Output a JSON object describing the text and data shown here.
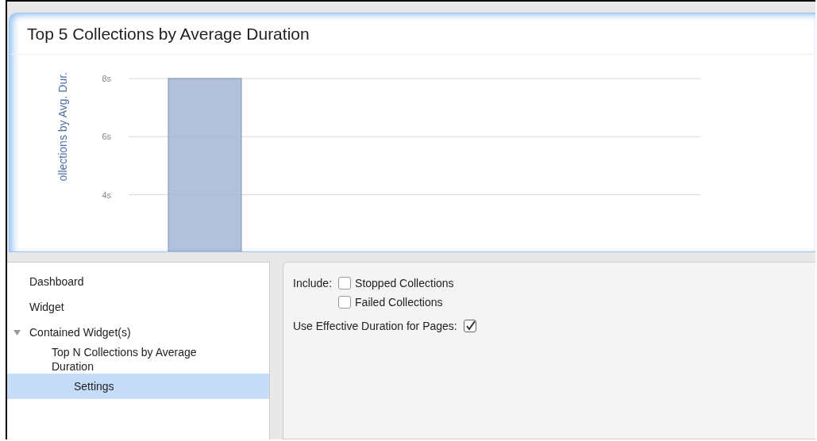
{
  "panel": {
    "title": "Top 5 Collections by Average Duration",
    "chart_data": {
      "type": "bar",
      "ylabel": "ollections by Avg. Dur.",
      "grid": true,
      "ylim": [
        2.05,
        8
      ],
      "yticks": [
        {
          "value": 4,
          "label": "4s"
        },
        {
          "value": 6,
          "label": "6s"
        },
        {
          "value": 8,
          "label": "8s"
        }
      ],
      "series": [
        {
          "color": "#a4b6d2",
          "values": [
            8
          ]
        }
      ]
    }
  },
  "tree": [
    {
      "label": "Dashboard",
      "selected": false
    },
    {
      "label": "Widget",
      "selected": false
    },
    {
      "label": "Contained Widget(s)",
      "selected": false,
      "expanded": true,
      "children": [
        {
          "label": "Top N Collections by Average Duration",
          "selected": false,
          "children": [
            {
              "label": "Settings",
              "selected": true
            }
          ]
        }
      ]
    }
  ],
  "settings": {
    "include_label": "Include:",
    "include_options": [
      {
        "label": "Stopped Collections",
        "checked": false
      },
      {
        "label": "Failed Collections",
        "checked": false
      }
    ],
    "effective_duration": {
      "label": "Use Effective Duration for Pages:",
      "checked": true
    }
  }
}
